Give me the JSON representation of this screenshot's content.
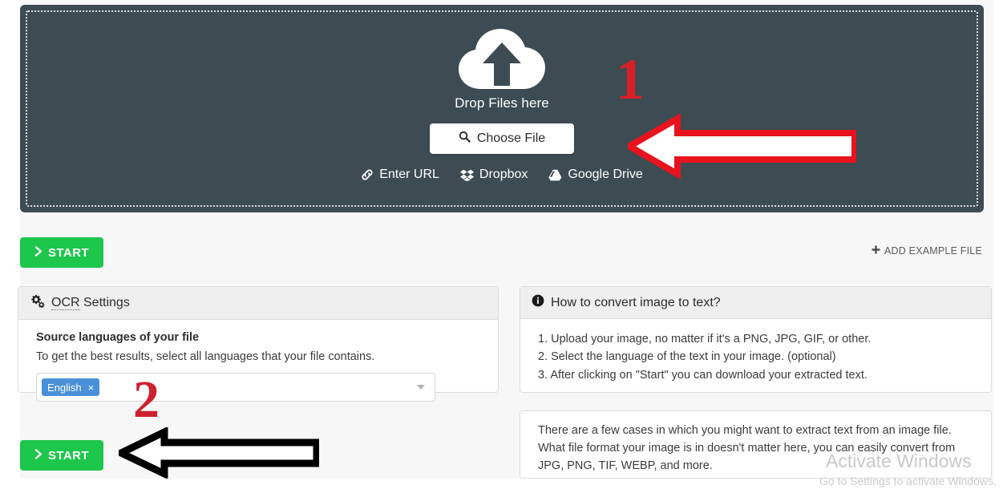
{
  "dropzone": {
    "icon": "cloud-upload-icon",
    "drop_label": "Drop Files here",
    "choose_file_label": "Choose File",
    "choose_file_icon": "search-icon",
    "links": [
      {
        "label": "Enter URL",
        "icon": "link-icon"
      },
      {
        "label": "Dropbox",
        "icon": "dropbox-icon"
      },
      {
        "label": "Google Drive",
        "icon": "google-drive-icon"
      }
    ]
  },
  "toolbar": {
    "start_label": "START",
    "start_icon": "chevron-right-icon",
    "add_example_label": "ADD EXAMPLE FILE",
    "add_example_icon": "plus-icon"
  },
  "ocr_panel": {
    "icon": "gears-icon",
    "title_abbr": "OCR",
    "title_rest": " Settings",
    "field_title": "Source languages of your file",
    "field_desc": "To get the best results, select all languages that your file contains.",
    "selected_languages": [
      {
        "label": "English",
        "remove": "×"
      }
    ],
    "caret_icon": "chevron-down-icon",
    "start_label": "START",
    "start_icon": "chevron-right-icon"
  },
  "howto_panel": {
    "icon": "info-icon",
    "title": "How to convert image to text?",
    "steps": [
      "1. Upload your image, no matter if it's a PNG, JPG, GIF, or other.",
      "2. Select the language of the text in your image. (optional)",
      "3. After clicking on \"Start\" you can download your extracted text."
    ]
  },
  "info_panel": {
    "paragraph": "There are a few cases in which you might want to extract text from an image file. What file format your image is in doesn't matter here, you can easily convert from JPG, PNG, TIF, WEBP, and more."
  },
  "annotations": {
    "step_one": "1",
    "step_two": "2",
    "arrow_one": "red-left-arrow",
    "arrow_two": "black-left-arrow"
  },
  "watermark": {
    "line1": "Activate Windows",
    "line2": "Go to Settings to activate Windows."
  },
  "colors": {
    "dropzone_bg": "#3d4b52",
    "start_green": "#1cc74b",
    "annotation_red": "#d81f26",
    "tag_blue": "#4a90d9",
    "page_bg": "#f7f7f7"
  }
}
